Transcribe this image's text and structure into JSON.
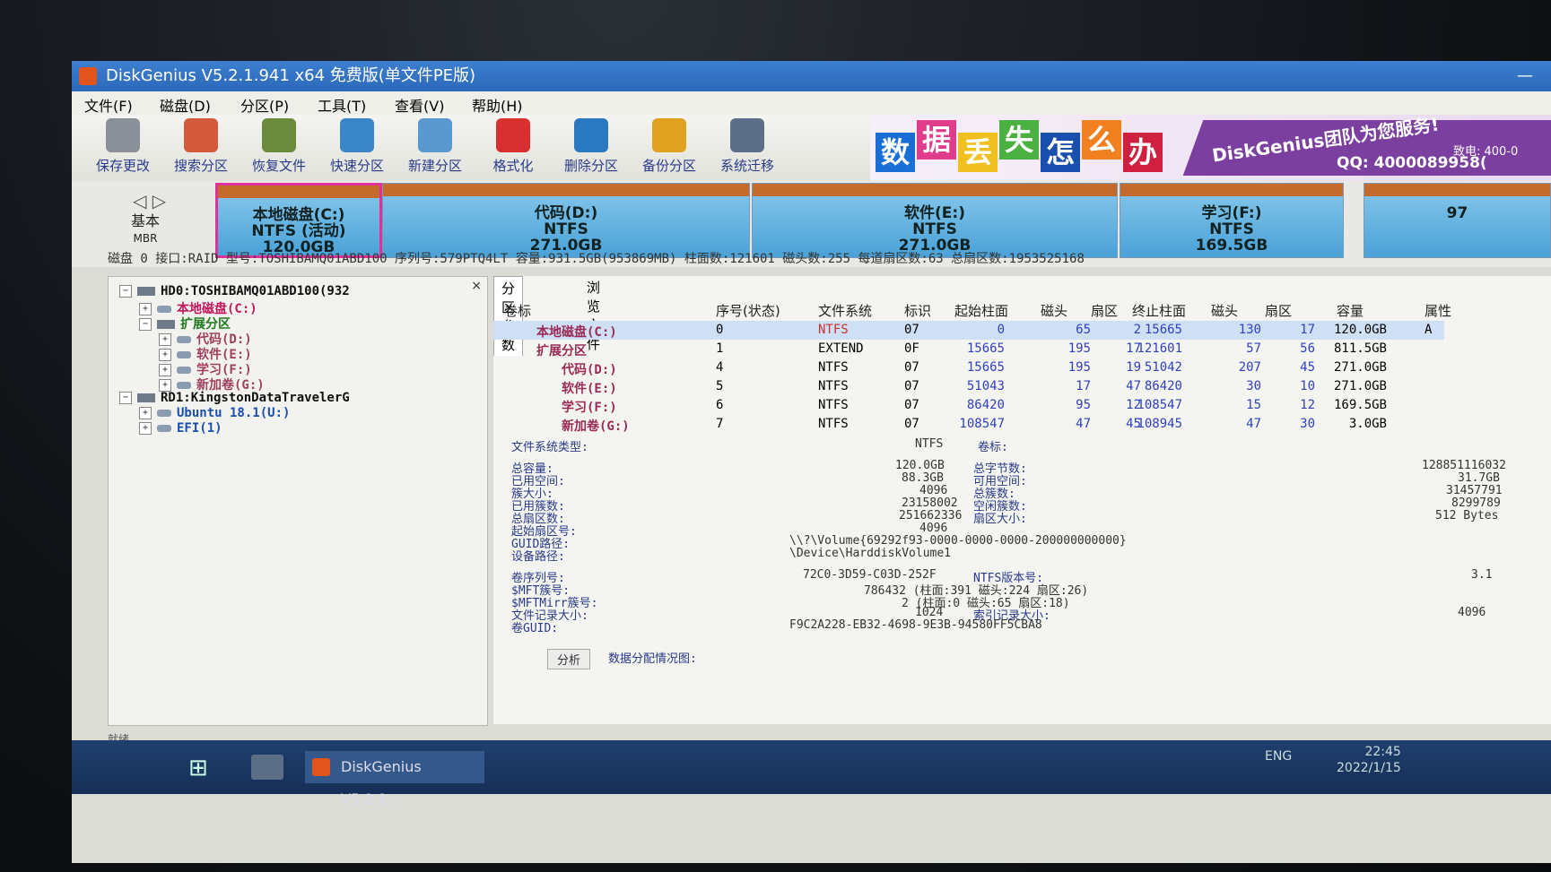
{
  "window": {
    "title": "DiskGenius V5.2.1.941 x64 免费版(单文件PE版)",
    "minimize": "—"
  },
  "menu": [
    "文件(F)",
    "磁盘(D)",
    "分区(P)",
    "工具(T)",
    "查看(V)",
    "帮助(H)"
  ],
  "toolbar": [
    {
      "label": "保存更改",
      "icon": "save-icon",
      "color": "#8a8f98"
    },
    {
      "label": "搜索分区",
      "icon": "magnifier-icon",
      "color": "#d35a3c"
    },
    {
      "label": "恢复文件",
      "icon": "restore-icon",
      "color": "#6a8a3c"
    },
    {
      "label": "快速分区",
      "icon": "quick-partition-icon",
      "color": "#3a86c8"
    },
    {
      "label": "新建分区",
      "icon": "new-partition-icon",
      "color": "#5a98d0"
    },
    {
      "label": "格式化",
      "icon": "format-icon",
      "color": "#d83030"
    },
    {
      "label": "删除分区",
      "icon": "trash-icon",
      "color": "#2a78c0"
    },
    {
      "label": "备份分区",
      "icon": "backup-pie-icon",
      "color": "#e0a020"
    },
    {
      "label": "系统迁移",
      "icon": "migrate-icon",
      "color": "#5d6e88"
    }
  ],
  "banner": {
    "tiles": [
      {
        "t": "数",
        "c": "#1a6fd6"
      },
      {
        "t": "据",
        "c": "#e03c8c"
      },
      {
        "t": "丢",
        "c": "#f0c020"
      },
      {
        "t": "失",
        "c": "#4ab040"
      },
      {
        "t": "怎",
        "c": "#1a4fb0"
      },
      {
        "t": "么",
        "c": "#f08020"
      },
      {
        "t": "办",
        "c": "#d02040"
      }
    ],
    "slogan": "DiskGenius团队为您服务!",
    "phone": "致电: 400-0",
    "qq": "QQ: 4000089958("
  },
  "diskmap": {
    "nav_back": "◁",
    "nav_forward": "▷",
    "type": "基本",
    "scheme": "MBR",
    "partitions": [
      {
        "name": "本地磁盘(C:)",
        "fs": "NTFS (活动)",
        "size": "120.0GB",
        "selected": true
      },
      {
        "name": "代码(D:)",
        "fs": "NTFS",
        "size": "271.0GB",
        "selected": false
      },
      {
        "name": "软件(E:)",
        "fs": "NTFS",
        "size": "271.0GB",
        "selected": false
      },
      {
        "name": "学习(F:)",
        "fs": "NTFS",
        "size": "169.5GB",
        "selected": false
      },
      {
        "name": "",
        "fs": "",
        "size": "97",
        "selected": false
      }
    ]
  },
  "diskinfo": "磁盘 0 接口:RAID  型号:TOSHIBAMQ01ABD100  序列号:579PTQ4LT  容量:931.5GB(953869MB)  柱面数:121601  磁头数:255  每道扇区数:63  总扇区数:1953525168",
  "tree": {
    "close": "×",
    "nodes": [
      {
        "label": "HD0:TOSHIBAMQ01ABD100(932",
        "indent": 0,
        "kind": "disk",
        "color": "#111"
      },
      {
        "label": "本地磁盘(C:)",
        "indent": 1,
        "kind": "part",
        "color": "#c2185b"
      },
      {
        "label": "扩展分区",
        "indent": 1,
        "kind": "ext",
        "color": "#207a20"
      },
      {
        "label": "代码(D:)",
        "indent": 2,
        "kind": "part",
        "color": "#a04060"
      },
      {
        "label": "软件(E:)",
        "indent": 2,
        "kind": "part",
        "color": "#a04060"
      },
      {
        "label": "学习(F:)",
        "indent": 2,
        "kind": "part",
        "color": "#a04060"
      },
      {
        "label": "新加卷(G:)",
        "indent": 2,
        "kind": "part",
        "color": "#a04060"
      },
      {
        "label": "RD1:KingstonDataTravelerG",
        "indent": 0,
        "kind": "disk",
        "color": "#111"
      },
      {
        "label": "Ubuntu 18.1(U:)",
        "indent": 1,
        "kind": "part",
        "color": "#1a4fb0"
      },
      {
        "label": "EFI(1)",
        "indent": 1,
        "kind": "part",
        "color": "#1a4fb0"
      }
    ]
  },
  "tabs": [
    "分区参数",
    "浏览文件"
  ],
  "ptable": {
    "headers": [
      "卷标",
      "序号(状态)",
      "文件系统",
      "标识",
      "起始柱面",
      "磁头",
      "扇区",
      "终止柱面",
      "磁头",
      "扇区",
      "容量",
      "属性"
    ],
    "rows": [
      [
        "本地磁盘(C:)",
        "0",
        "NTFS",
        "07",
        "0",
        "65",
        "2",
        "15665",
        "130",
        "17",
        "120.0GB",
        "A"
      ],
      [
        "扩展分区",
        "1",
        "EXTEND",
        "0F",
        "15665",
        "195",
        "17",
        "121601",
        "57",
        "56",
        "811.5GB",
        ""
      ],
      [
        "代码(D:)",
        "4",
        "NTFS",
        "07",
        "15665",
        "195",
        "19",
        "51042",
        "207",
        "45",
        "271.0GB",
        ""
      ],
      [
        "软件(E:)",
        "5",
        "NTFS",
        "07",
        "51043",
        "17",
        "47",
        "86420",
        "30",
        "10",
        "271.0GB",
        ""
      ],
      [
        "学习(F:)",
        "6",
        "NTFS",
        "07",
        "86420",
        "95",
        "12",
        "108547",
        "15",
        "12",
        "169.5GB",
        ""
      ],
      [
        "新加卷(G:)",
        "7",
        "NTFS",
        "07",
        "108547",
        "47",
        "45",
        "108945",
        "47",
        "30",
        "3.0GB",
        ""
      ]
    ]
  },
  "fsinfo": {
    "fs_type_label": "文件系统类型:",
    "fs_type": "NTFS",
    "vol_label": "卷标:",
    "total_label": "总容量:",
    "total": "120.0GB",
    "total_bytes_label": "总字节数:",
    "total_bytes": "128851116032",
    "used_label": "已用空间:",
    "used": "88.3GB",
    "free_label": "可用空间:",
    "free": "31.7GB",
    "cluster_label": "簇大小:",
    "cluster": "4096",
    "total_clusters_label": "总簇数:",
    "total_clusters": "31457791",
    "used_clusters_label": "已用簇数:",
    "used_clusters": "23158002",
    "free_clusters_label": "空闲簇数:",
    "free_clusters": "8299789",
    "total_sectors_label": "总扇区数:",
    "total_sectors": "251662336",
    "sector_size_label": "扇区大小:",
    "sector_size": "512 Bytes",
    "start_sector_label": "起始扇区号:",
    "start_sector": "4096",
    "guid_path_label": "GUID路径:",
    "guid_path": "\\\\?\\Volume{69292f93-0000-0000-0000-200000000000}",
    "device_path_label": "设备路径:",
    "device_path": "\\Device\\HarddiskVolume1",
    "serial_label": "卷序列号:",
    "serial": "72C0-3D59-C03D-252F",
    "ntfs_ver_label": "NTFS版本号:",
    "ntfs_ver": "3.1",
    "mft_label": "$MFT簇号:",
    "mft": "786432 (柱面:391 磁头:224 扇区:26)",
    "mftmirr_label": "$MFTMirr簇号:",
    "mftmirr": "2 (柱面:0 磁头:65 扇区:18)",
    "record_label": "文件记录大小:",
    "record": "1024",
    "index_label": "索引记录大小:",
    "index": "4096",
    "guid_label": "卷GUID:",
    "guid": "F9C2A228-EB32-4698-9E3B-94580FF5CBA8",
    "analyze": "分析",
    "alloc_label": "数据分配情况图:"
  },
  "statusbar": "就绪",
  "taskbar": {
    "start": "⊞",
    "task": "DiskGenius V5.2.1...",
    "ime": "ENG",
    "time": "22:45",
    "date": "2022/1/15"
  }
}
